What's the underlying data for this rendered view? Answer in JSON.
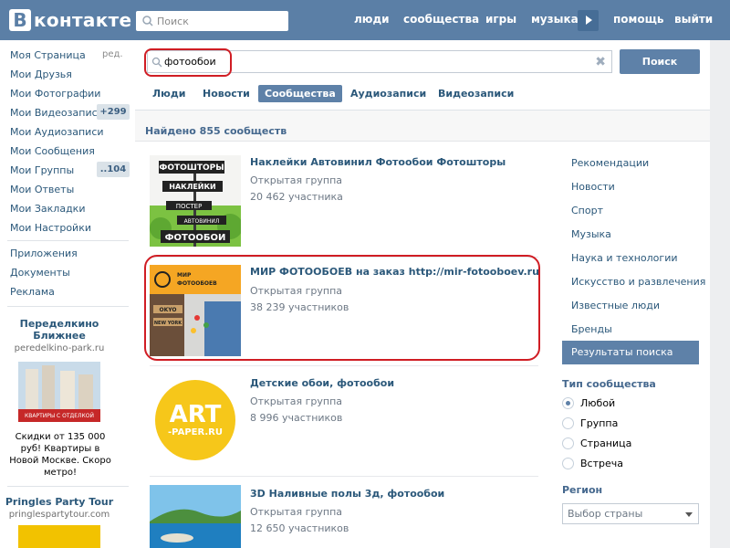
{
  "header": {
    "logo_letter": "В",
    "logo_text": "контакте",
    "search_placeholder": "Поиск",
    "nav": [
      "люди",
      "сообщества",
      "игры",
      "музыка",
      "помощь",
      "выйти"
    ]
  },
  "left_menu": {
    "edit_label": "ред.",
    "items": [
      {
        "label": "Моя Страница"
      },
      {
        "label": "Мои Друзья"
      },
      {
        "label": "Мои Фотографии"
      },
      {
        "label": "Мои Видеозаписи",
        "badge": "+299"
      },
      {
        "label": "Мои Аудиозаписи"
      },
      {
        "label": "Мои Сообщения"
      },
      {
        "label": "Мои Группы",
        "badge": "..104"
      },
      {
        "label": "Мои Ответы"
      },
      {
        "label": "Мои Закладки"
      },
      {
        "label": "Мои Настройки"
      }
    ],
    "extra": [
      "Приложения",
      "Документы",
      "Реклама"
    ]
  },
  "ads": [
    {
      "title": "Переделкино Ближнее",
      "url": "peredelkino-park.ru",
      "banner": "КВАРТИРЫ С ОТДЕЛКОЙ",
      "text": "Скидки от 135 000 руб! Квартиры в Новой Москве. Скоро метро!"
    },
    {
      "title": "Pringles Party Tour",
      "url": "pringlespartytour.com"
    }
  ],
  "search": {
    "value": "фотообои",
    "button": "Поиск"
  },
  "tabs": [
    "Люди",
    "Новости",
    "Сообщества",
    "Аудиозаписи",
    "Видеозаписи"
  ],
  "active_tab": "Сообщества",
  "found_text": "Найдено 855 сообществ",
  "results": [
    {
      "title": "Наклейки Автовинил Фотообои Фотошторы",
      "type": "Открытая группа",
      "count": "20 462 участника",
      "img_words": [
        "ФОТОШТОРЫ",
        "НАКЛЕЙКИ",
        "ПОСТЕР",
        "АВТОВИНИЛ",
        "ФОТООБОИ"
      ]
    },
    {
      "title": "МИР ФОТООБОЕВ на заказ http://mir-fotooboev.ru",
      "type": "Открытая группа",
      "count": "38 239 участников",
      "img_words": [
        "МИР",
        "ФОТООБОЕВ",
        "OKYO",
        "NEW YORK"
      ]
    },
    {
      "title": "Детские обои, фотообои",
      "type": "Открытая группа",
      "count": "8 996 участников",
      "img_words": [
        "ART",
        "-PAPER.RU"
      ]
    },
    {
      "title": "3D Наливные полы 3д, фотообои",
      "type": "Открытая группа",
      "count": "12 650 участников"
    }
  ],
  "filters": {
    "categories": [
      "Рекомендации",
      "Новости",
      "Спорт",
      "Музыка",
      "Наука и технологии",
      "Искусство и развлечения",
      "Известные люди",
      "Бренды",
      "Результаты поиска"
    ],
    "active_category": "Результаты поиска",
    "type_heading": "Тип сообщества",
    "types": [
      "Любой",
      "Группа",
      "Страница",
      "Встреча"
    ],
    "selected_type": "Любой",
    "region_heading": "Регион",
    "region_placeholder": "Выбор страны"
  },
  "colors": {
    "header_bg": "#5b7fa6",
    "accent": "#5e81a8",
    "link": "#2b587a",
    "highlight_red": "#d01d24"
  }
}
